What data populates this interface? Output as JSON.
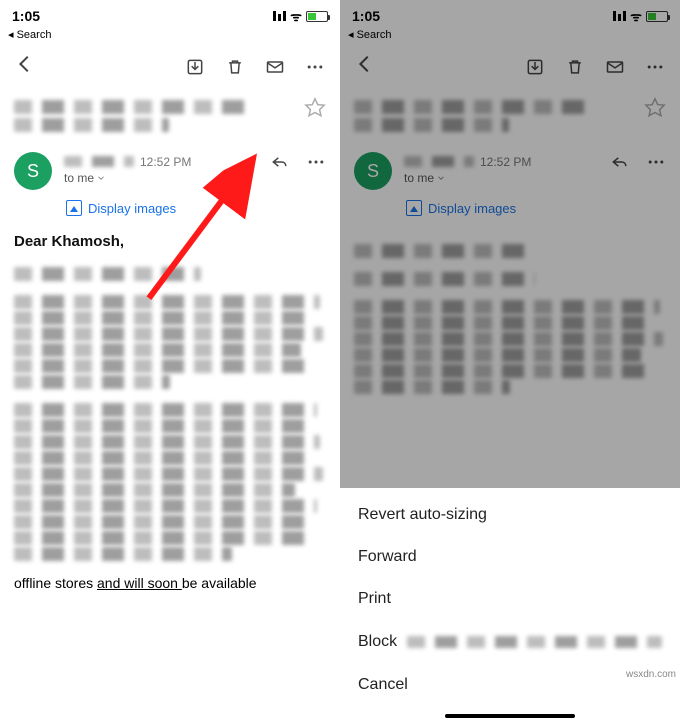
{
  "status": {
    "time": "1:05",
    "back": "Search"
  },
  "toolbar_icons": {
    "archive": "archive",
    "delete": "delete",
    "mail": "mail",
    "more": "more"
  },
  "avatar_letter": "S",
  "timestamp": "12:52 PM",
  "to_line": "to me",
  "display_images": "Display images",
  "greeting": "Dear Khamosh,",
  "footer_line": "offline stores and will soon be available",
  "sheet": {
    "revert": "Revert auto-sizing",
    "forward": "Forward",
    "print": "Print",
    "block": "Block",
    "cancel": "Cancel"
  },
  "watermark": "wsxdn.com"
}
